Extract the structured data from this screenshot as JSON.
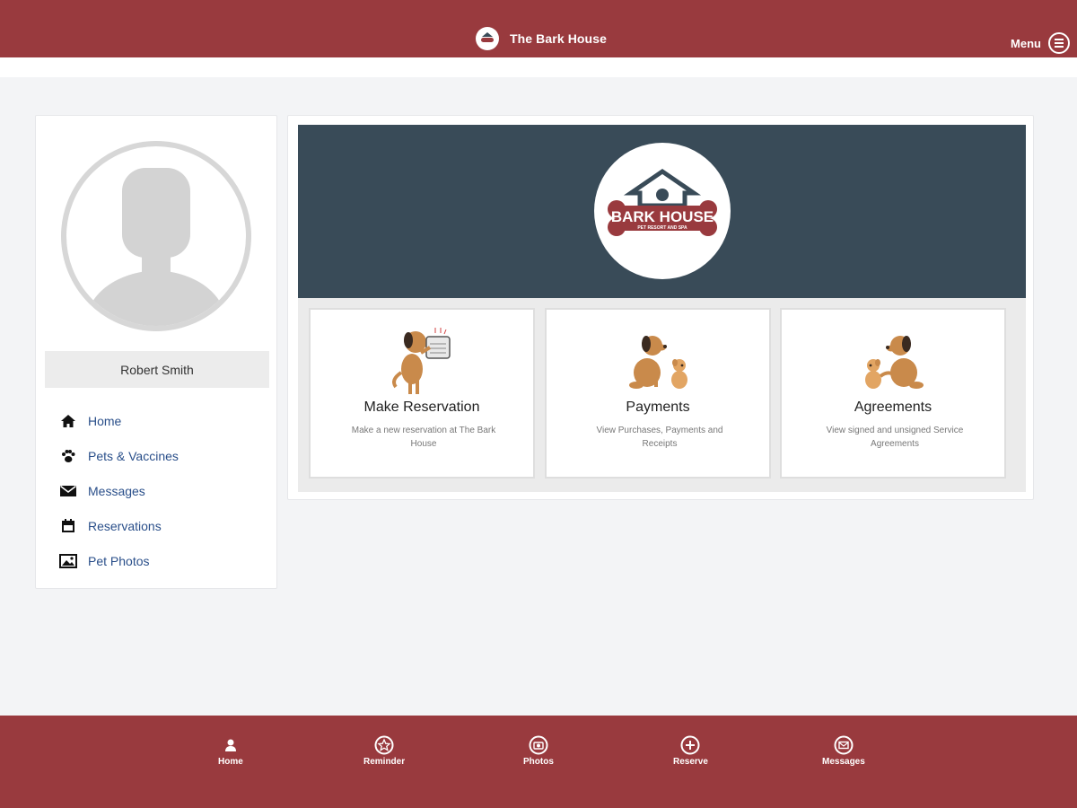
{
  "header": {
    "title": "The Bark House",
    "menu_label": "Menu"
  },
  "sidebar": {
    "user_name": "Robert Smith",
    "items": [
      {
        "label": "Home",
        "icon": "home-icon"
      },
      {
        "label": "Pets & Vaccines",
        "icon": "paw-icon"
      },
      {
        "label": "Messages",
        "icon": "envelope-icon"
      },
      {
        "label": "Reservations",
        "icon": "calendar-icon"
      },
      {
        "label": "Pet Photos",
        "icon": "photo-icon"
      }
    ]
  },
  "hero": {
    "logo_line1": "BARK HOUSE",
    "logo_line2": "PET RESORT AND SPA"
  },
  "cards": [
    {
      "title": "Make Reservation",
      "desc": "Make a new reservation at The Bark House"
    },
    {
      "title": "Payments",
      "desc": "View Purchases, Payments and Receipts"
    },
    {
      "title": "Agreements",
      "desc": "View signed and unsigned Service Agreements"
    }
  ],
  "bottom_nav": [
    {
      "label": "Home",
      "icon": "user-icon"
    },
    {
      "label": "Reminder",
      "icon": "star-icon"
    },
    {
      "label": "Photos",
      "icon": "camera-icon"
    },
    {
      "label": "Reserve",
      "icon": "plus-icon"
    },
    {
      "label": "Messages",
      "icon": "mail-icon"
    }
  ],
  "colors": {
    "brand": "#993a3e",
    "hero_bg": "#394b58",
    "link": "#2a4f8a"
  }
}
